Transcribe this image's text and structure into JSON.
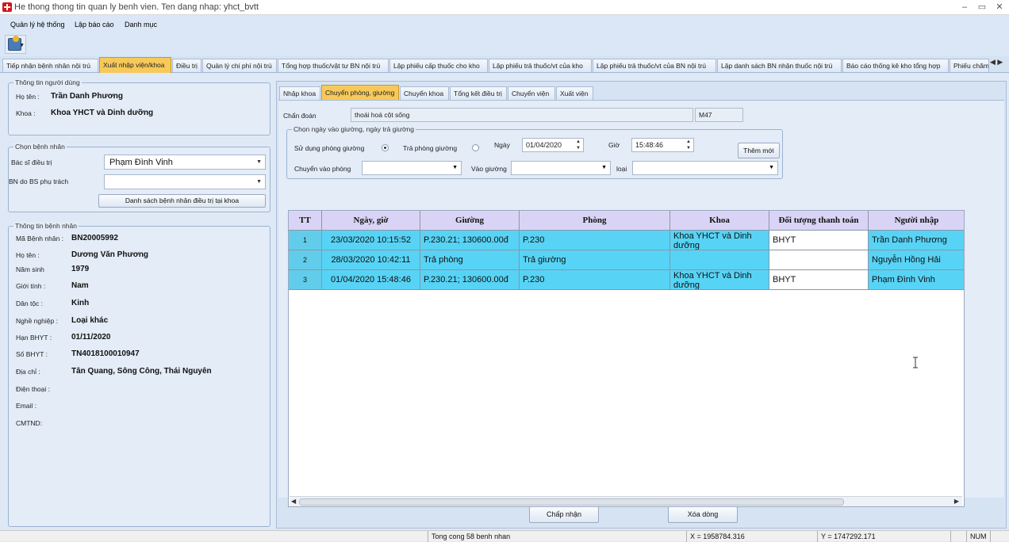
{
  "window": {
    "title": "He thong thong tin quan ly benh vien. Ten dang nhap: yhct_bvtt",
    "controls": [
      "–",
      "▭",
      "✕"
    ]
  },
  "menu": {
    "items": [
      "Quản lý hệ thống",
      "Lập báo cáo",
      "Danh mục"
    ]
  },
  "main_tabs": [
    "Tiếp nhận bệnh nhân nội trú",
    "Xuất nhập viện/khoa",
    "Điều trị",
    "Quản lý chi phí nội trú",
    "Tổng hợp thuốc/vật tư BN nội trú",
    "Lập phiếu cấp thuốc cho kho",
    "Lập phiếu trả thuốc/vt của kho",
    "Lập phiếu trả thuốc/vt của BN nội trú",
    "Lập danh sách BN nhận thuốc nội trú",
    "Báo cáo thống kê kho tổng hợp",
    "Phiếu chăm"
  ],
  "main_tabs_active": 1,
  "user_info": {
    "legend": "Thông tin người dùng",
    "name_label": "Họ tên :",
    "name": "Trần Danh Phương",
    "dept_label": "Khoa :",
    "dept": "Khoa YHCT và Dinh dưỡng"
  },
  "choose_patient": {
    "legend": "Chọn bệnh nhân",
    "doctor_label": "Bác sĩ điều trị",
    "doctor": "Phạm Đình Vinh",
    "bs_label": "BN do BS phụ trách",
    "bs_value": "",
    "list_button": "Danh sách bệnh nhân điều trị tại khoa"
  },
  "patient_info": {
    "legend": "Thông tin bệnh nhân",
    "fields": [
      {
        "label": "Mã Bệnh nhân :",
        "value": "BN20005992"
      },
      {
        "label": "Họ tên :",
        "value": "Dương Văn Phương"
      },
      {
        "label": "Năm sinh",
        "value": "1979"
      },
      {
        "label": "Giới tính :",
        "value": "Nam"
      },
      {
        "label": "Dân tộc :",
        "value": "Kinh"
      },
      {
        "label": "Nghề nghiệp :",
        "value": "Loại khác"
      },
      {
        "label": "Hạn BHYT :",
        "value": "01/11/2020"
      },
      {
        "label": "Số BHYT :",
        "value": "TN4018100010947"
      },
      {
        "label": "Địa chỉ :",
        "value": "Tân Quang, Sông Công, Thái Nguyên"
      },
      {
        "label": "Điện thoại :",
        "value": ""
      },
      {
        "label": "Email :",
        "value": ""
      },
      {
        "label": "CMTND:",
        "value": ""
      }
    ]
  },
  "sub_tabs": [
    "Nhập khoa",
    "Chuyển phòng, giường",
    "Chuyển khoa",
    "Tổng kết điều trị",
    "Chuyển viện",
    "Xuất viện"
  ],
  "sub_tabs_active": 1,
  "form": {
    "diagnosis_label": "Chẩn đoán",
    "diagnosis": "thoái hoá cột sống",
    "icd": "M47",
    "group_legend": "Chọn ngày vào giường, ngày trả giường",
    "use_bed_label": "Sử dụng phòng giường",
    "use_bed_checked": true,
    "return_bed_label": "Trả phòng giường",
    "return_bed_checked": false,
    "date_label": "Ngày",
    "date": "01/04/2020",
    "time_label": "Giờ",
    "time": "15:48:46",
    "add_button": "Thêm mới",
    "room_label": "Chuyển vào phòng",
    "room": "",
    "bed_label": "Vào giường",
    "bed": "",
    "type_label": "loại",
    "type": ""
  },
  "table": {
    "columns": [
      "TT",
      "Ngày, giờ",
      "Giường",
      "Phòng",
      "Khoa",
      "Đối tượng thanh toán",
      "Người nhập"
    ],
    "rows": [
      [
        "1",
        "23/03/2020 10:15:52",
        "P.230.21; 130600.00đ",
        "P.230",
        "Khoa YHCT và Dinh dưỡng",
        "BHYT",
        "Trần Danh Phương"
      ],
      [
        "2",
        "28/03/2020 10:42:11",
        "Trả phòng",
        "Trả giường",
        "",
        "",
        "Nguyễn Hồng Hải"
      ],
      [
        "3",
        "01/04/2020 15:48:46",
        "P.230.21; 130600.00đ",
        "P.230",
        "Khoa YHCT và Dinh dưỡng",
        "BHYT",
        "Phạm Đình Vinh"
      ]
    ]
  },
  "buttons": {
    "accept": "Chấp nhận",
    "delete_row": "Xóa dòng"
  },
  "status": {
    "total": "Tong cong 58 benh nhan",
    "x": "X = 1958784.316",
    "y": "Y = 1747292.171",
    "num": "NUM"
  }
}
